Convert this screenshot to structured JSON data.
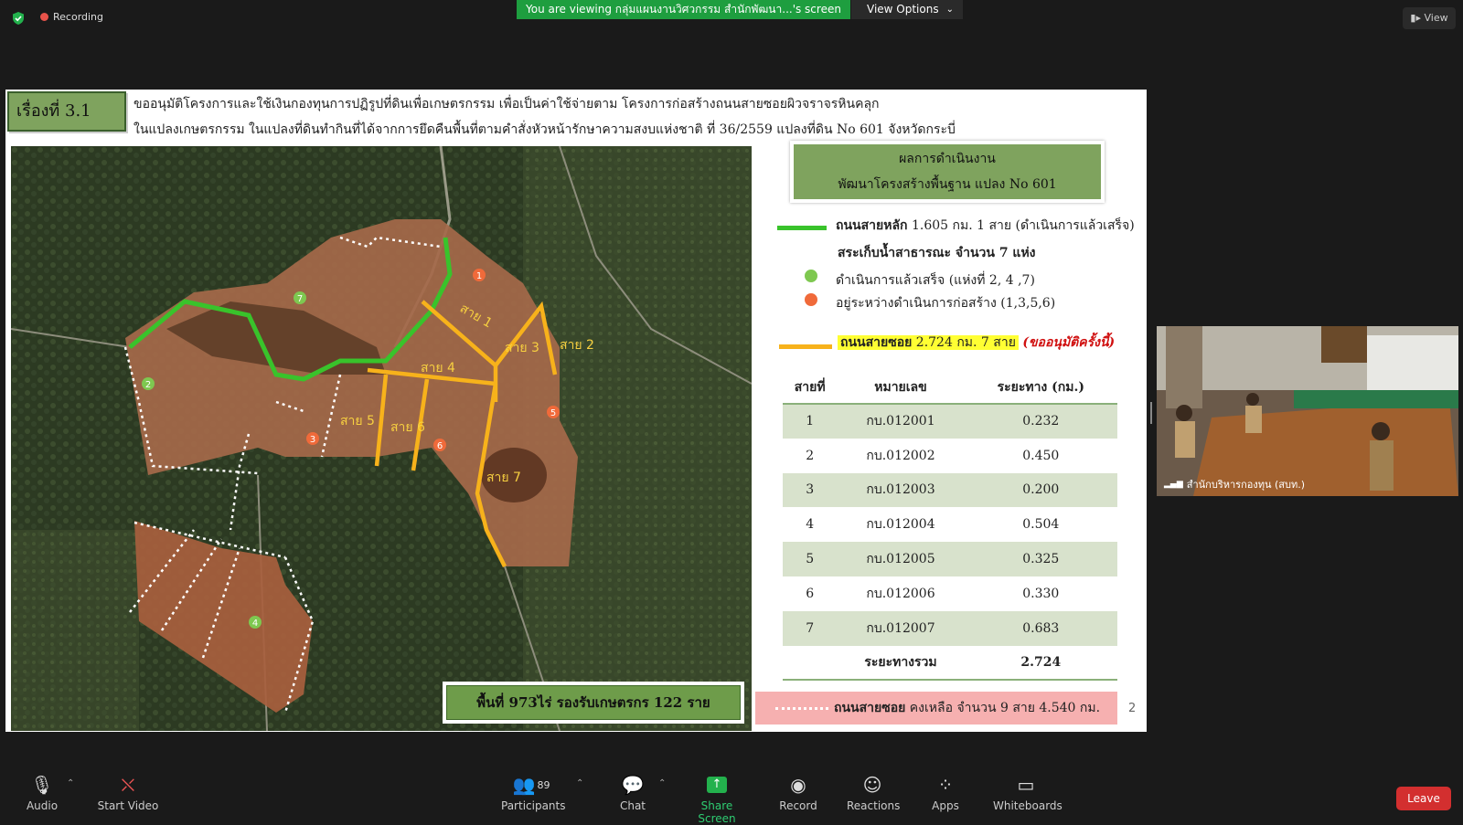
{
  "topbar": {
    "recording": "Recording",
    "viewing": "You are viewing กลุ่มแผนงานวิศวกรรม สำนักพัฒนา...'s screen",
    "view_options": "View Options",
    "view": "View"
  },
  "slide": {
    "title": "เรื่องที่ 3.1",
    "head_line1": "ขออนุมัติโครงการและใช้เงินกองทุนการปฏิรูปที่ดินเพื่อเกษตรกรรม เพื่อเป็นค่าใช้จ่ายตาม โครงการก่อสร้างถนนสายซอยผิวจราจรหินคลุก",
    "head_line2": "ในแปลงเกษตรกรรม ในแปลงที่ดินทำกินที่ได้จากการยึดคืนพื้นที่ตามคำสั่งหัวหน้ารักษาความสงบแห่งชาติ ที่ 36/2559 แปลงที่ดิน No 601 จังหวัดกระบี่",
    "area_label": "พื้นที่ 973ไร่ รองรับเกษตรกร 122 ราย",
    "results_line1": "ผลการดำเนินงาน",
    "results_line2": "พัฒนาโครงสร้างพื้นฐาน แปลง No 601",
    "legend_main_road_bold": "ถนนสายหลัก",
    "legend_main_road_rest": "1.605 กม. 1 สาย (ดำเนินการแล้วเสร็จ)",
    "legend_ponds": "สระเก็บน้ำสาธารณะ จำนวน 7 แห่ง",
    "legend_done": "ดำเนินการแล้วเสร็จ (แห่งที่ 2, 4 ,7)",
    "legend_progress": "อยู่ระหว่างดำเนินการก่อสร้าง (1,3,5,6)",
    "legend_sub_bold": "ถนนสายซอย",
    "legend_sub_rest": "2.724 กม. 7 สาย",
    "legend_sub_note": "(ขออนุมัติครั้งนี้)",
    "table_headers": [
      "สายที่",
      "หมายเลข",
      "ระยะทาง (กม.)"
    ],
    "table_rows": [
      [
        "1",
        "กบ.012001",
        "0.232"
      ],
      [
        "2",
        "กบ.012002",
        "0.450"
      ],
      [
        "3",
        "กบ.012003",
        "0.200"
      ],
      [
        "4",
        "กบ.012004",
        "0.504"
      ],
      [
        "5",
        "กบ.012005",
        "0.325"
      ],
      [
        "6",
        "กบ.012006",
        "0.330"
      ],
      [
        "7",
        "กบ.012007",
        "0.683"
      ]
    ],
    "total_label": "ระยะทางรวม",
    "total_value": "2.724",
    "remain_bold": "ถนนสายซอย",
    "remain_rest": "คงเหลือ จำนวน 9 สาย 4.540 กม.",
    "page": "2",
    "map_labels": {
      "r1": "สาย 1",
      "r2": "สาย 2",
      "r3": "สาย 3",
      "r4": "สาย 4",
      "r5": "สาย 5",
      "r6": "สาย 6",
      "r7": "สาย 7"
    },
    "pond_numbers": [
      "1",
      "2",
      "3",
      "4",
      "5",
      "6",
      "7"
    ]
  },
  "video": {
    "name": "สำนักบริหารกองทุน (สบท.)"
  },
  "toolbar": {
    "audio": "Audio",
    "start_video": "Start Video",
    "participants": "Participants",
    "participants_count": "89",
    "chat": "Chat",
    "share_screen": "Share Screen",
    "record": "Record",
    "reactions": "Reactions",
    "apps": "Apps",
    "whiteboards": "Whiteboards",
    "leave": "Leave"
  },
  "colors": {
    "share_green": "#1e9e3f",
    "leave_red": "#d32f2f",
    "main_road": "#39c32b",
    "sub_road": "#f7b21b",
    "pond_done": "#7ec850",
    "pond_progress": "#f06a3a"
  }
}
